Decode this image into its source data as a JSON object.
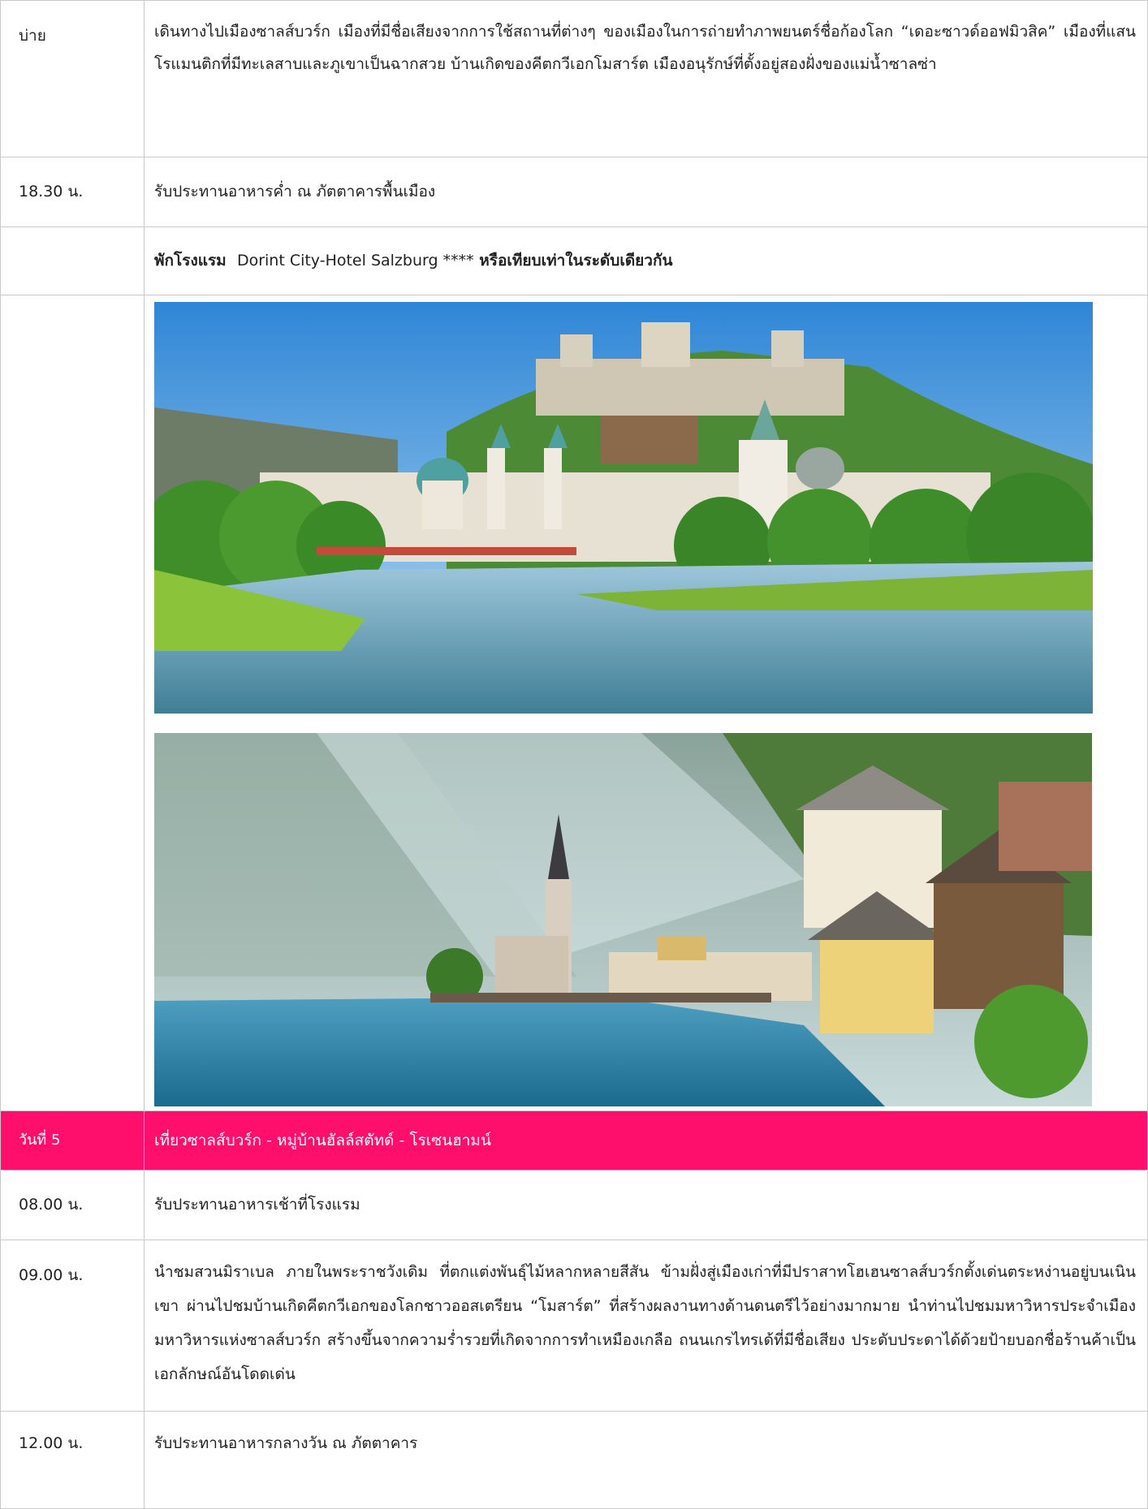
{
  "rows": [
    {
      "time": "บ่าย",
      "text": "เดินทางไปเมืองซาลส์บวร์ก เมืองที่มีชื่อเสียงจากการใช้สถานที่ต่างๆ ของเมืองในการถ่ายทำภาพยนตร์ชื่อก้องโลก “เดอะซาวด์ออฟมิวสิค” เมืองที่แสนโรแมนติกที่มีทะเลสาบและภูเขาเป็นฉากสวย บ้านเกิดของคีตกวีเอกโมสาร์ต เมืองอนุรักษ์ที่ตั้งอยู่สองฝั่งของแม่น้ำซาลซ่า"
    },
    {
      "time": "18.30 น.",
      "text": "รับประทานอาหารค่ำ ณ ภัตตาคารพื้นเมือง"
    },
    {
      "time": "",
      "hotel_prefix": "พักโรงแรม",
      "hotel_name": "Dorint City-Hotel Salzburg ****",
      "hotel_suffix": "หรือเทียบเท่าในระดับเดียวกัน"
    },
    {
      "time": "",
      "images": [
        "salzburg-photo",
        "hallstatt-photo"
      ]
    },
    {
      "time": "วันที่ 5",
      "text": "เที่ยวซาลส์บวร์ก - หมู่บ้านฮัลล์สตัทด์ - โรเซนฮามน์"
    },
    {
      "time": "08.00 น.",
      "text": "รับประทานอาหารเช้าที่โรงแรม"
    },
    {
      "time": "09.00 น.",
      "text": "นำชมสวนมิราเบล ภายในพระราชวังเดิม ที่ตกแต่งพันธุ์ไม้หลากหลายสีสัน ข้ามฝั่งสู่เมืองเก่าที่มีปราสาทโฮเฮนซาลส์บวร์กตั้งเด่นตระหง่านอยู่บนเนินเขา ผ่านไปชมบ้านเกิดคีตกวีเอกของโลกชาวออสเตรียน “โมสาร์ต” ที่สร้างผลงานทางด้านดนตรีไว้อย่างมากมาย นำท่านไปชมมหาวิหารประจำเมือง มหาวิหารแห่งซาลส์บวร์ก สร้างขึ้นจากความร่ำรวยที่เกิดจากการทำเหมืองเกลือ ถนนเกรไทรเด้ที่มีชื่อเสียง ประดับประดาได้ด้วยป้ายบอกชื่อร้านค้าเป็นเอกลักษณ์อันโดดเด่น"
    },
    {
      "time": "12.00 น.",
      "text": "รับประทานอาหารกลางวัน ณ ภัตตาคาร"
    }
  ],
  "colors": {
    "day_header_bg": "#fd0f6b",
    "border": "#c9c9c9"
  }
}
